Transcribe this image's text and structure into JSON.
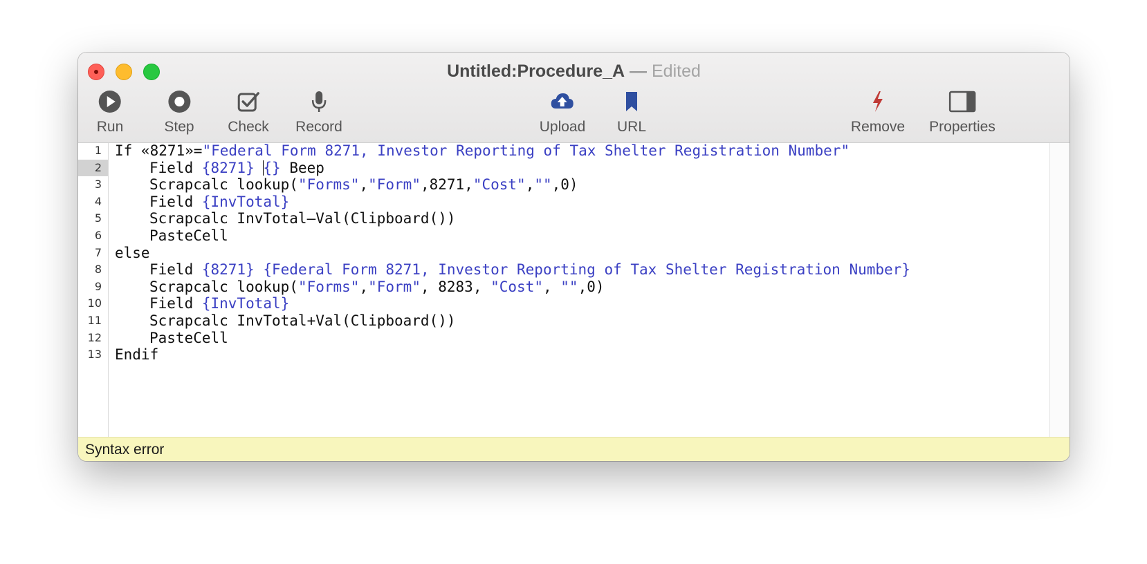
{
  "window": {
    "title_name": "Untitled:Procedure_A",
    "title_sep": "—",
    "title_state": "Edited"
  },
  "toolbar": {
    "run": "Run",
    "step": "Step",
    "check": "Check",
    "record": "Record",
    "upload": "Upload",
    "url": "URL",
    "remove": "Remove",
    "properties": "Properties"
  },
  "icons": {
    "run": "play-circle-icon",
    "step": "step-circle-icon",
    "check": "checkbox-icon",
    "record": "microphone-icon",
    "upload": "cloud-upload-icon",
    "url": "bookmark-icon",
    "remove": "lightning-bolt-icon",
    "properties": "sidebar-panel-icon"
  },
  "colors": {
    "string": "#3b40c3",
    "upload_icon": "#2f4fa0",
    "remove_icon": "#c03a36",
    "status_bg": "#f8f6bd"
  },
  "editor": {
    "current_line": 2,
    "lines": [
      {
        "n": "1",
        "indent": 0,
        "parts": [
          {
            "t": "If «8271»="
          },
          {
            "t": "\"Federal Form 8271, Investor Reporting of Tax Shelter Registration Number\"",
            "s": 1
          }
        ]
      },
      {
        "n": "2",
        "indent": 1,
        "parts": [
          {
            "t": "Field "
          },
          {
            "t": "{8271}",
            "s": 1
          },
          {
            "t": " "
          },
          {
            "caret": 1
          },
          {
            "t": "{}",
            "s": 1
          },
          {
            "t": " Beep"
          }
        ]
      },
      {
        "n": "3",
        "indent": 1,
        "parts": [
          {
            "t": "Scrapcalc lookup("
          },
          {
            "t": "\"Forms\"",
            "s": 1
          },
          {
            "t": ","
          },
          {
            "t": "\"Form\"",
            "s": 1
          },
          {
            "t": ",8271,"
          },
          {
            "t": "\"Cost\"",
            "s": 1
          },
          {
            "t": ","
          },
          {
            "t": "\"\"",
            "s": 1
          },
          {
            "t": ",0)"
          }
        ]
      },
      {
        "n": "4",
        "indent": 1,
        "parts": [
          {
            "t": "Field "
          },
          {
            "t": "{InvTotal}",
            "s": 1
          }
        ]
      },
      {
        "n": "5",
        "indent": 1,
        "parts": [
          {
            "t": "Scrapcalc InvTotal–Val(Clipboard())"
          }
        ]
      },
      {
        "n": "6",
        "indent": 1,
        "parts": [
          {
            "t": "PasteCell"
          }
        ]
      },
      {
        "n": "7",
        "indent": 0,
        "parts": [
          {
            "t": "else"
          }
        ]
      },
      {
        "n": "8",
        "indent": 1,
        "parts": [
          {
            "t": "Field "
          },
          {
            "t": "{8271}",
            "s": 1
          },
          {
            "t": " "
          },
          {
            "t": "{Federal Form 8271, Investor Reporting of Tax Shelter Registration Number}",
            "s": 1
          }
        ]
      },
      {
        "n": "9",
        "indent": 1,
        "parts": [
          {
            "t": "Scrapcalc lookup("
          },
          {
            "t": "\"Forms\"",
            "s": 1
          },
          {
            "t": ","
          },
          {
            "t": "\"Form\"",
            "s": 1
          },
          {
            "t": ", 8283, "
          },
          {
            "t": "\"Cost\"",
            "s": 1
          },
          {
            "t": ", "
          },
          {
            "t": "\"\"",
            "s": 1
          },
          {
            "t": ",0)"
          }
        ]
      },
      {
        "n": "10",
        "indent": 1,
        "parts": [
          {
            "t": "Field "
          },
          {
            "t": "{InvTotal}",
            "s": 1
          }
        ]
      },
      {
        "n": "11",
        "indent": 1,
        "parts": [
          {
            "t": "Scrapcalc InvTotal+Val(Clipboard())"
          }
        ]
      },
      {
        "n": "12",
        "indent": 1,
        "parts": [
          {
            "t": "PasteCell"
          }
        ]
      },
      {
        "n": "13",
        "indent": 0,
        "parts": [
          {
            "t": "Endif"
          }
        ]
      }
    ]
  },
  "status": {
    "message": "Syntax error"
  }
}
